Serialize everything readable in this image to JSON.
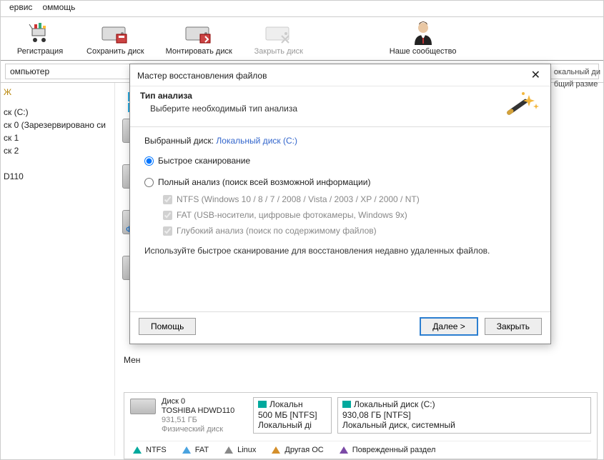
{
  "menus": {
    "service": "ервис",
    "help": "оммощь"
  },
  "toolbar": {
    "register": "Регистрация",
    "save_disk": "Сохранить диск",
    "mount_disk": "Монтировать диск",
    "close_disk": "Закрыть диск",
    "community": "Наше сообщество"
  },
  "breadcrumb": "омпьютер",
  "sidebar": {
    "j_letter": "Ж",
    "items": [
      "ск (C:)",
      "ск 0 (Зарезервировано си",
      "ск 1",
      "ск 2",
      "",
      "D110"
    ]
  },
  "linkF": "Ф",
  "right": {
    "line1": "окальный ди",
    "line2": "бщий разме"
  },
  "bottom_menu": "Мен",
  "disk_footer": {
    "model_line1": "Диск 0",
    "model_line2": "TOSHIBA HDWD110",
    "total_size": "931,51 ГБ",
    "type": "Физический диск",
    "part1": {
      "name": "Локальн",
      "size": "500 МБ [NTFS]",
      "desc": "Локальный ді"
    },
    "part2": {
      "name": "Локальный диск (C:)",
      "size": "930,08 ГБ [NTFS]",
      "desc": "Локальный диск, системный"
    }
  },
  "legend": {
    "ntfs": "NTFS",
    "fat": "FAT",
    "linux": "Linux",
    "other": "Другая ОС",
    "damaged": "Поврежденный раздел"
  },
  "wizard": {
    "window_title": "Мастер восстановления файлов",
    "section_title": "Тип анализа",
    "subtitle": "Выберите необходимый тип анализа",
    "selected_disk_label": "Выбранный диск:",
    "selected_disk_value": "Локальный диск (C:)",
    "opt_fast": "Быстрое сканирование",
    "opt_full": "Полный анализ (поиск всей возможной информации)",
    "chk_ntfs": "NTFS (Windows 10 / 8 / 7 / 2008 / Vista / 2003 / XP / 2000 / NT)",
    "chk_fat": "FAT (USB-носители, цифровые фотокамеры, Windows 9x)",
    "chk_deep": "Глубокий анализ (поиск по содержимому файлов)",
    "hint": "Используйте быстрое сканирование для восстановления недавно удаленных файлов.",
    "btn_help": "Помощь",
    "btn_next": "Далее >",
    "btn_close": "Закрыть"
  }
}
